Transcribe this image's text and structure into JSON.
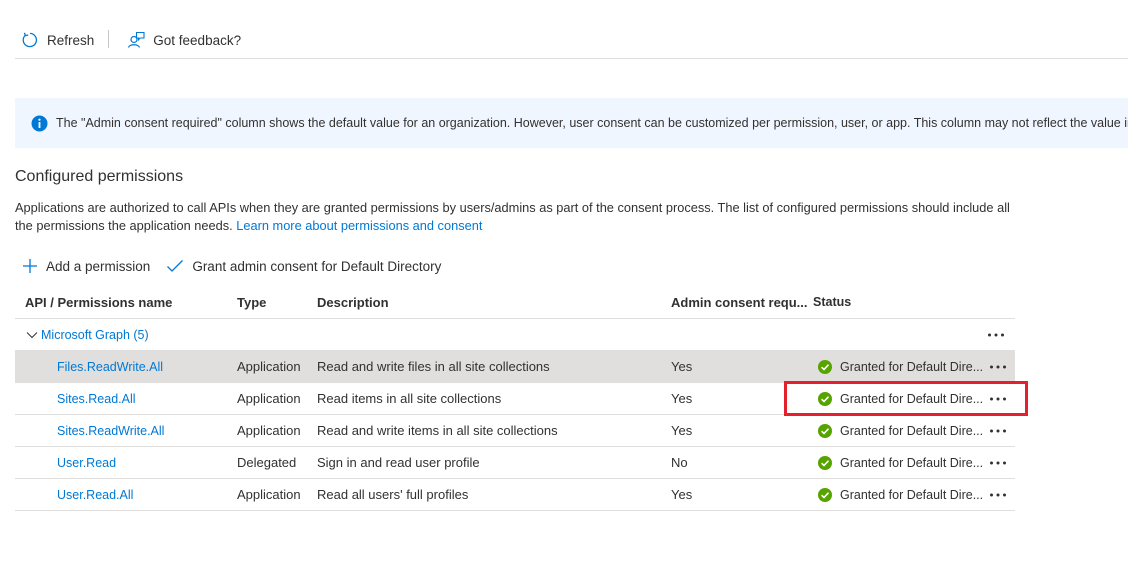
{
  "toolbar": {
    "refresh_label": "Refresh",
    "feedback_label": "Got feedback?"
  },
  "banner": {
    "text": "The \"Admin consent required\" column shows the default value for an organization. However, user consent can be customized per permission, user, or app. This column may not reflect the value in your organization, or in organizations where this app will be used."
  },
  "section": {
    "title": "Configured permissions",
    "description": "Applications are authorized to call APIs when they are granted permissions by users/admins as part of the consent process. The list of configured permissions should include all the permissions the application needs.",
    "link_text": "Learn more about permissions and consent"
  },
  "actions": {
    "add_permission": "Add a permission",
    "grant_consent": "Grant admin consent for Default Directory"
  },
  "table": {
    "headers": [
      "API / Permissions name",
      "Type",
      "Description",
      "Admin consent requ...",
      "Status"
    ],
    "group": {
      "label": "Microsoft Graph (5)"
    },
    "rows": [
      {
        "name": "Files.ReadWrite.All",
        "type": "Application",
        "description": "Read and write files in all site collections",
        "admin_consent": "Yes",
        "status": "Granted for Default Dire..."
      },
      {
        "name": "Sites.Read.All",
        "type": "Application",
        "description": "Read items in all site collections",
        "admin_consent": "Yes",
        "status": "Granted for Default Dire..."
      },
      {
        "name": "Sites.ReadWrite.All",
        "type": "Application",
        "description": "Read and write items in all site collections",
        "admin_consent": "Yes",
        "status": "Granted for Default Dire..."
      },
      {
        "name": "User.Read",
        "type": "Delegated",
        "description": "Sign in and read user profile",
        "admin_consent": "No",
        "status": "Granted for Default Dire..."
      },
      {
        "name": "User.Read.All",
        "type": "Application",
        "description": "Read all users' full profiles",
        "admin_consent": "Yes",
        "status": "Granted for Default Dire..."
      }
    ]
  },
  "colors": {
    "accent": "#0078d4",
    "granted": "#57a300",
    "highlight": "#e3212d",
    "banner_bg": "#f0f6ff",
    "selected_row": "#e1dfdd"
  },
  "icons": {
    "refresh": "refresh-icon",
    "feedback": "feedback-icon",
    "info": "info-icon",
    "add": "plus-icon",
    "grant": "checkmark-icon",
    "granted": "check-circle-icon",
    "more": "more-icon",
    "expand": "chevron-down-icon"
  }
}
